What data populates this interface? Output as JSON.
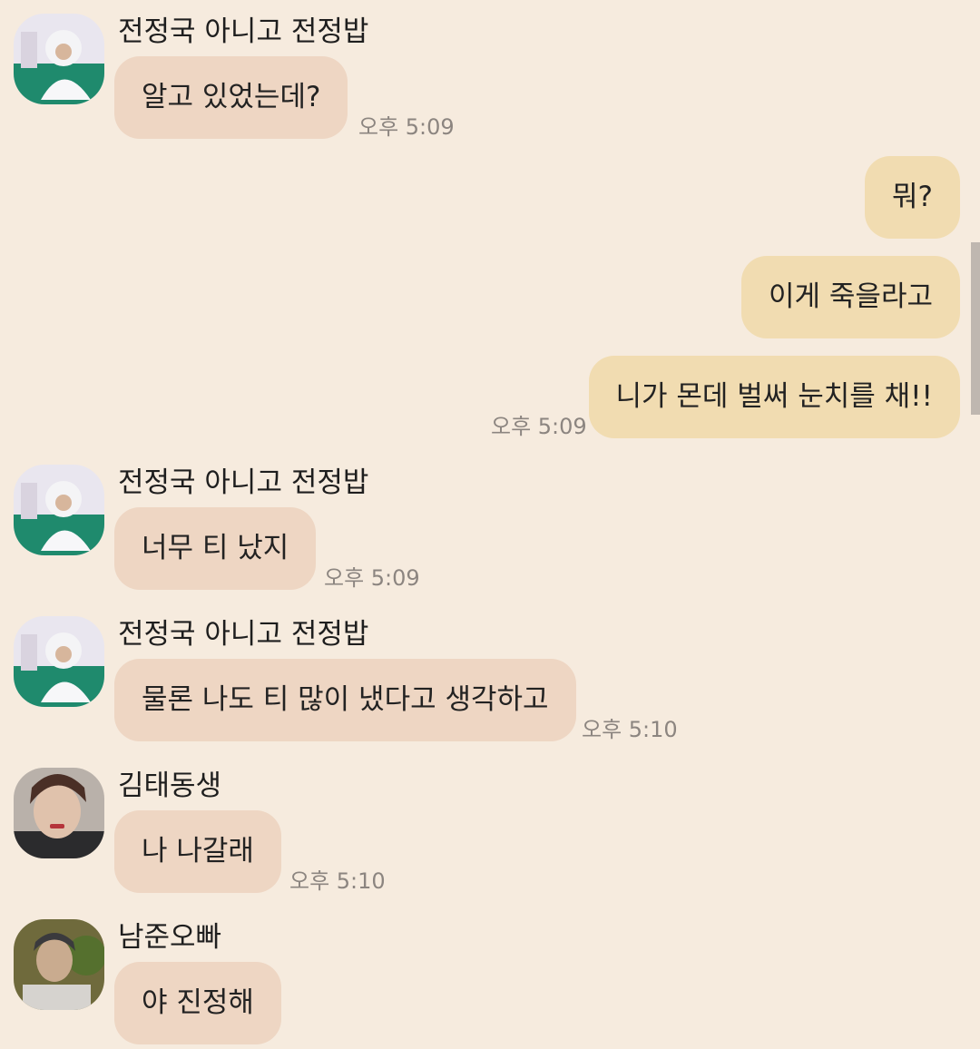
{
  "messages": [
    {
      "sender": "전정국 아니고 전정밥",
      "text": "알고 있었는데?",
      "time": "오후 5:09"
    },
    {
      "text": "뭐?"
    },
    {
      "text": "이게 죽을라고"
    },
    {
      "text": "니가 몬데 벌써 눈치를 채!!",
      "time": "오후 5:09"
    },
    {
      "sender": "전정국 아니고 전정밥",
      "text": "너무 티 났지",
      "time": "오후 5:09"
    },
    {
      "sender": "전정국 아니고 전정밥",
      "text": "물론 나도 티 많이 냈다고 생각하고",
      "time": "오후 5:10"
    },
    {
      "sender": "김태동생",
      "text": "나 나갈래",
      "time": "오후 5:10"
    },
    {
      "sender": "남준오빠",
      "text": "야 진정해"
    }
  ],
  "colors": {
    "background": "#f6ebde",
    "incoming_bubble": "#eed6c3",
    "outgoing_bubble": "#f1dcb1",
    "timestamp": "#8c8580"
  }
}
